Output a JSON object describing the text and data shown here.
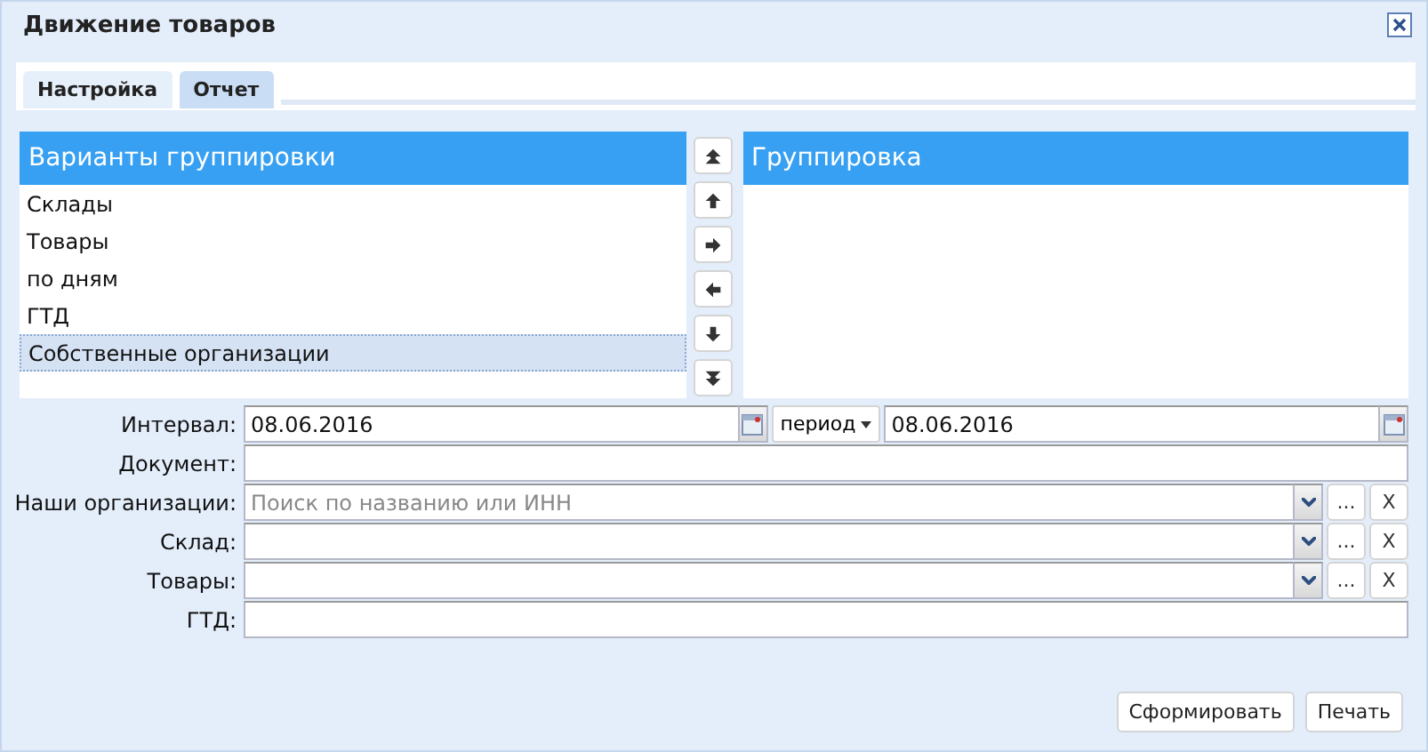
{
  "window": {
    "title": "Движение товаров"
  },
  "tabs": [
    {
      "label": "Настройка",
      "selected": false
    },
    {
      "label": "Отчет",
      "selected": true
    }
  ],
  "grouping_options": {
    "title": "Варианты группировки",
    "items": [
      {
        "label": "Склады",
        "selected": false
      },
      {
        "label": "Товары",
        "selected": false
      },
      {
        "label": "по дням",
        "selected": false
      },
      {
        "label": "ГТД",
        "selected": false
      },
      {
        "label": "Собственные организации",
        "selected": true
      }
    ]
  },
  "grouping": {
    "title": "Группировка"
  },
  "fields": [
    {
      "kind": "interval",
      "label": "Интервал:",
      "value": "08.06.2016",
      "period": "период",
      "value_to": "08.06.2016"
    },
    {
      "kind": "text",
      "label": "Документ:"
    },
    {
      "kind": "combo",
      "label": "Наши организации:",
      "placeholder": "Поиск по названию или ИНН",
      "more": "...",
      "clear": "X"
    },
    {
      "kind": "combo",
      "label": "Склад:",
      "more": "...",
      "clear": "X"
    },
    {
      "kind": "combo",
      "label": "Товары:",
      "more": "...",
      "clear": "X"
    },
    {
      "kind": "text",
      "label": "ГТД:"
    }
  ],
  "buttons": [
    "Сформировать",
    "Печать"
  ]
}
